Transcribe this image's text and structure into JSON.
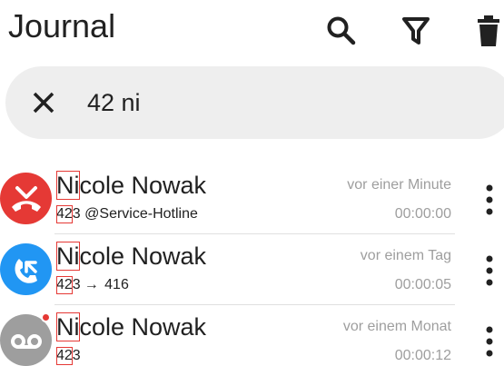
{
  "app_title": "Journal",
  "header": {
    "search_icon": "search-icon",
    "filter_icon": "filter-icon",
    "delete_icon": "trash-icon"
  },
  "search": {
    "value": "42 ni",
    "clear_icon": "close-icon"
  },
  "colors": {
    "missed": "#e53935",
    "outgoing": "#2196f3",
    "voicemail": "#9e9e9e",
    "highlight_box": "#e53935",
    "secondary_text": "#9e9e9e"
  },
  "entries": [
    {
      "type": "missed",
      "icon": "missed-call-icon",
      "name_match": "Ni",
      "name_rest": "cole Nowak",
      "number_match": "42",
      "number_rest": "3",
      "detail": "@Service-Hotline",
      "time_relative": "vor einer Minute",
      "duration": "00:00:00"
    },
    {
      "type": "outgoing-forwarded",
      "icon": "outgoing-call-icon",
      "name_match": "Ni",
      "name_rest": "cole Nowak",
      "number_match": "42",
      "number_rest": "3",
      "detail": "416",
      "time_relative": "vor einem Tag",
      "duration": "00:00:05"
    },
    {
      "type": "voicemail",
      "icon": "voicemail-icon",
      "badge": "unread-dot",
      "name_match": "Ni",
      "name_rest": "cole Nowak",
      "number_match": "42",
      "number_rest": "3",
      "detail": "",
      "time_relative": "vor einem Monat",
      "duration": "00:00:12"
    }
  ]
}
